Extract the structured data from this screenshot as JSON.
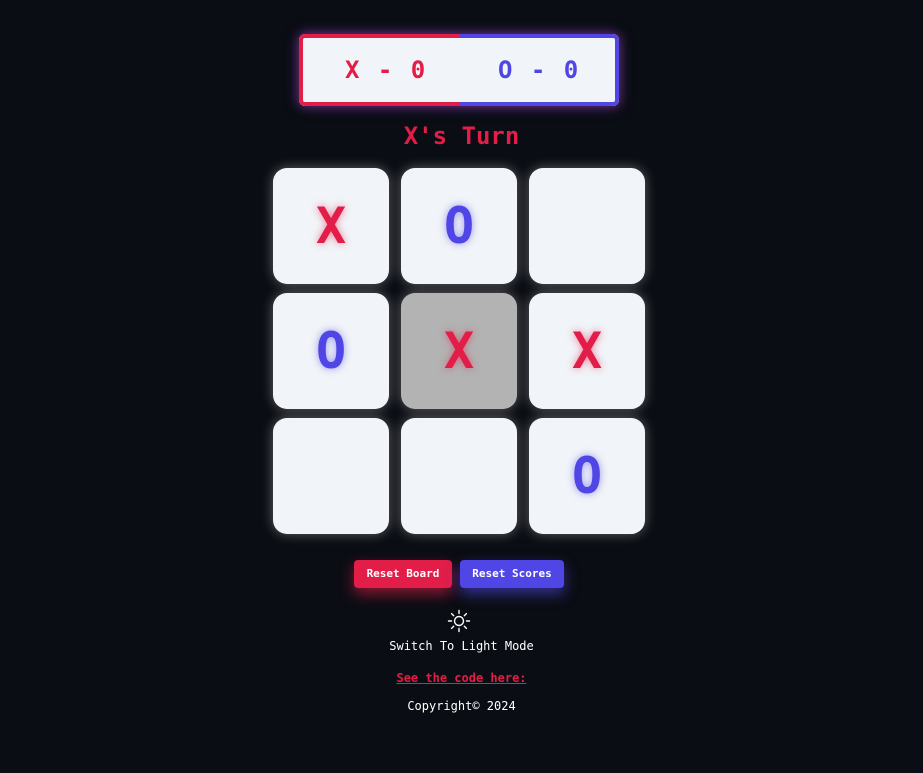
{
  "scoreboard": {
    "x_label": "X - 0",
    "o_label": "O - 0",
    "x_color": "#e11d48",
    "o_color": "#4f46e5"
  },
  "turn_text": "X's Turn",
  "board": {
    "cells": [
      "X",
      "O",
      "",
      "O",
      "X",
      "X",
      "",
      "",
      "O"
    ],
    "highlighted_cell": 4
  },
  "buttons": {
    "reset_board": "Reset Board",
    "reset_scores": "Reset Scores"
  },
  "theme_toggle": {
    "icon": "sun-icon",
    "label": "Switch To Light Mode"
  },
  "code_link": "See the code here:",
  "copyright": "Copyright© 2024"
}
